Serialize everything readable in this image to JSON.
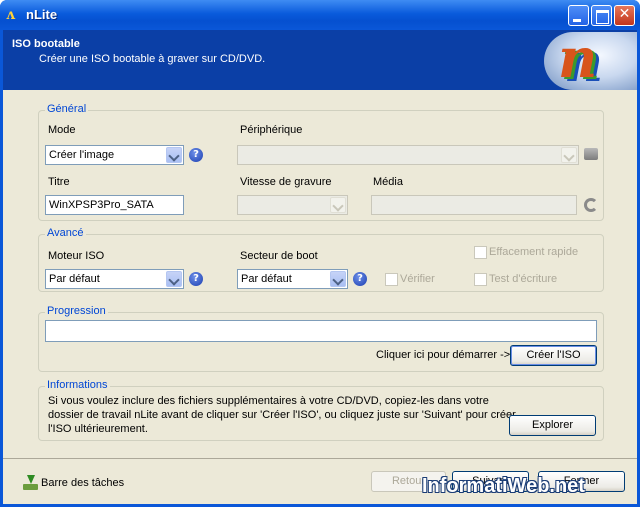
{
  "window": {
    "title": "nLite"
  },
  "header": {
    "title": "ISO bootable",
    "subtitle": "Créer une ISO bootable à graver sur CD/DVD."
  },
  "general": {
    "title": "Général",
    "mode_label": "Mode",
    "mode_value": "Créer l'image",
    "device_label": "Périphérique",
    "device_value": "",
    "titre_label": "Titre",
    "titre_value": "WinXPSP3Pro_SATA",
    "speed_label": "Vitesse de gravure",
    "media_label": "Média"
  },
  "advanced": {
    "title": "Avancé",
    "engine_label": "Moteur ISO",
    "engine_value": "Par défaut",
    "boot_label": "Secteur de boot",
    "boot_value": "Par défaut",
    "verify_label": "Vérifier",
    "quick_erase_label": "Effacement rapide",
    "write_test_label": "Test d'écriture"
  },
  "progress": {
    "title": "Progression",
    "hint": "Cliquer ici pour démarrer ->",
    "create_button": "Créer l'ISO"
  },
  "info": {
    "title": "Informations",
    "text_line1": "Si vous voulez inclure des fichiers supplémentaires à votre CD/DVD, copiez-les dans votre",
    "text_line2": "dossier de travail nLite avant de cliquer sur 'Créer l'ISO', ou cliquez juste sur 'Suivant' pour créer",
    "text_line3": "l'ISO ultérieurement.",
    "explore_button": "Explorer"
  },
  "footer": {
    "taskbar_label": "Barre des tâches",
    "back_button": "Retour",
    "next_button": "Suivant",
    "close_button": "Fermer"
  },
  "watermark": "InformatiWeb.net",
  "colors": {
    "accent": "#0046d5",
    "titlebar": "#0a57d8",
    "header": "#0b3fa6",
    "dialog": "#ece9d8"
  }
}
